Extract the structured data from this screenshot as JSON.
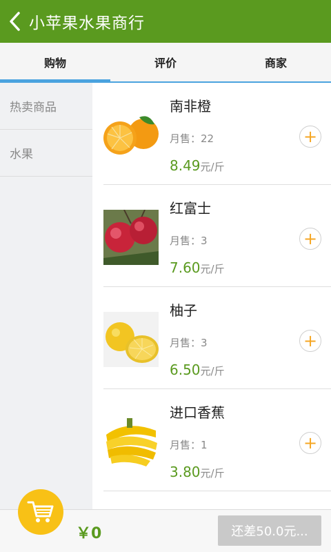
{
  "header": {
    "title": "小苹果水果商行",
    "back_icon": "chevron-left-icon"
  },
  "tabs": [
    {
      "label": "购物",
      "active": true
    },
    {
      "label": "评价",
      "active": false
    },
    {
      "label": "商家",
      "active": false
    }
  ],
  "sidebar": {
    "items": [
      {
        "label": "热卖商品"
      },
      {
        "label": "水果"
      }
    ]
  },
  "products": [
    {
      "name": "南非橙",
      "sales": "月售：22",
      "price": "8.49",
      "unit": "元/斤",
      "image": "orange"
    },
    {
      "name": "红富士",
      "sales": "月售：3",
      "price": "7.60",
      "unit": "元/斤",
      "image": "apple"
    },
    {
      "name": "柚子",
      "sales": "月售：3",
      "price": "6.50",
      "unit": "元/斤",
      "image": "grapefruit"
    },
    {
      "name": "进口香蕉",
      "sales": "月售：1",
      "price": "3.80",
      "unit": "元/斤",
      "image": "banana"
    }
  ],
  "add_button_symbol": "+",
  "cart": {
    "total": "￥0",
    "checkout_label": "还差50.0元...",
    "icon": "shopping-cart-icon"
  },
  "colors": {
    "header_bg": "#5a9a1f",
    "tab_indicator": "#4aa3df",
    "price": "#5a9a1f",
    "add_button": "#f5a623",
    "cart_button": "#f8c116",
    "checkout_disabled": "#c9c9c9"
  }
}
